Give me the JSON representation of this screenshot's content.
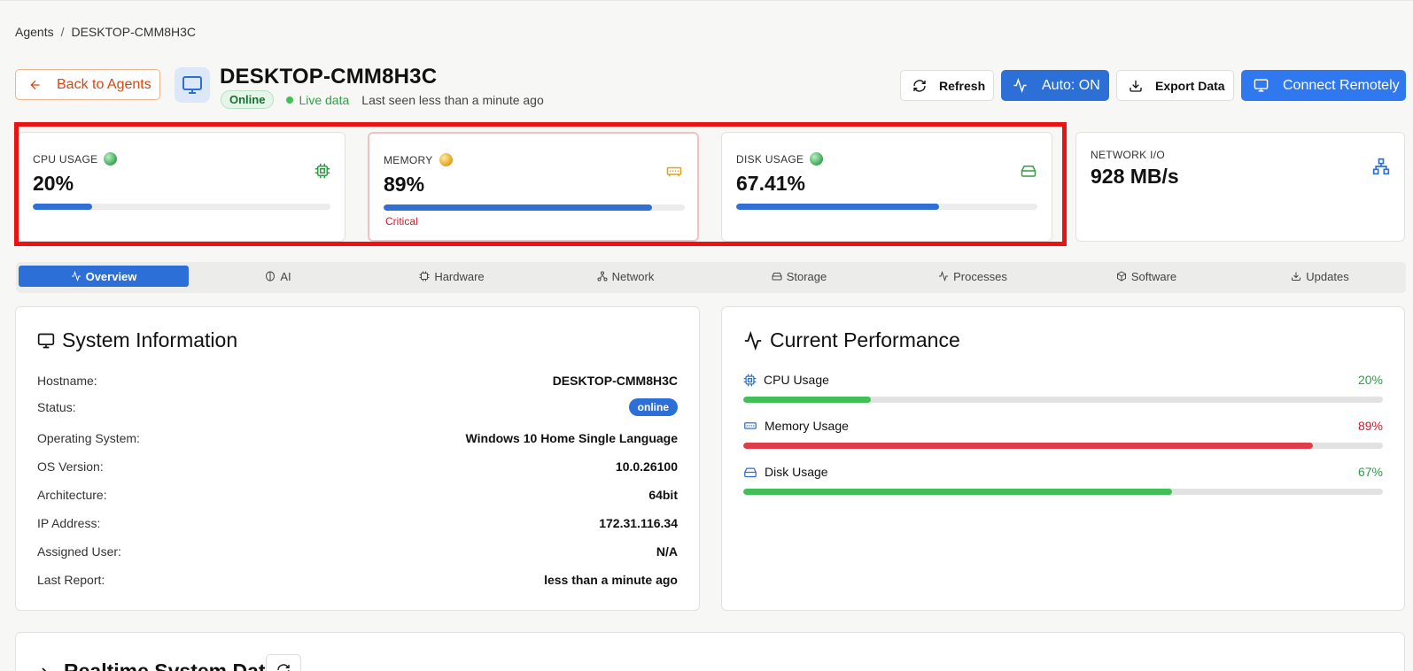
{
  "breadcrumb": {
    "parent": "Agents",
    "separator": "/",
    "current": "DESKTOP-CMM8H3C"
  },
  "header": {
    "back_label": "Back to Agents",
    "hostname": "DESKTOP-CMM8H3C",
    "status_pill": "Online",
    "live_label": "Live data",
    "last_seen": "Last seen less than a minute ago",
    "refresh_label": "Refresh",
    "auto_label": "Auto: ON",
    "export_label": "Export Data",
    "connect_label": "Connect Remotely"
  },
  "metrics": [
    {
      "label": "CPU USAGE",
      "value": "20%",
      "percent": 20,
      "status_color": "green",
      "icon": "cpu-icon"
    },
    {
      "label": "MEMORY",
      "value": "89%",
      "percent": 89,
      "status_color": "yellow",
      "icon": "memory-icon",
      "note": "Critical"
    },
    {
      "label": "DISK USAGE",
      "value": "67.41%",
      "percent": 67.41,
      "status_color": "green",
      "icon": "hard-drive-icon"
    },
    {
      "label": "NETWORK I/O",
      "value": "928 MB/s",
      "icon": "network-icon"
    }
  ],
  "tabs": [
    {
      "label": "Overview",
      "icon": "activity-icon",
      "active": true
    },
    {
      "label": "AI",
      "icon": "brain-icon"
    },
    {
      "label": "Hardware",
      "icon": "cpu-icon"
    },
    {
      "label": "Network",
      "icon": "network-icon"
    },
    {
      "label": "Storage",
      "icon": "hard-drive-icon"
    },
    {
      "label": "Processes",
      "icon": "activity-icon"
    },
    {
      "label": "Software",
      "icon": "package-icon"
    },
    {
      "label": "Updates",
      "icon": "download-icon"
    }
  ],
  "system_info": {
    "title": "System Information",
    "rows": [
      {
        "label": "Hostname:",
        "value": "DESKTOP-CMM8H3C"
      },
      {
        "label": "Status:",
        "value": "online"
      },
      {
        "label": "Operating System:",
        "value": "Windows 10 Home Single Language"
      },
      {
        "label": "OS Version:",
        "value": "10.0.26100"
      },
      {
        "label": "Architecture:",
        "value": "64bit"
      },
      {
        "label": "IP Address:",
        "value": "172.31.116.34"
      },
      {
        "label": "Assigned User:",
        "value": "N/A"
      },
      {
        "label": "Last Report:",
        "value": "less than a minute ago"
      }
    ]
  },
  "performance": {
    "title": "Current Performance",
    "items": [
      {
        "name": "CPU Usage",
        "value": "20%",
        "percent": 20,
        "color": "#40c057",
        "value_color": "#2f9e44"
      },
      {
        "name": "Memory Usage",
        "value": "89%",
        "percent": 89,
        "color": "#e03c4a",
        "value_color": "#d6162b"
      },
      {
        "name": "Disk Usage",
        "value": "67%",
        "percent": 67,
        "color": "#40c057",
        "value_color": "#2f9e44"
      }
    ]
  },
  "realtime": {
    "title": "Realtime System Data"
  },
  "colors": {
    "primary": "#2c6fd6",
    "highlight": "#ee1111",
    "progress": "#2f6fd6"
  }
}
